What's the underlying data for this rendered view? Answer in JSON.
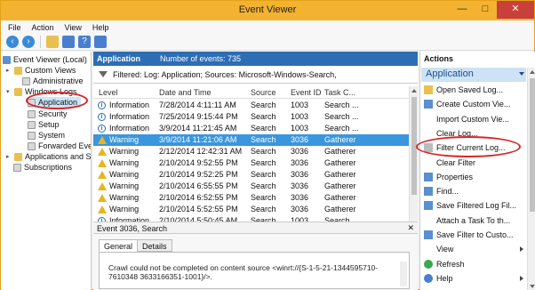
{
  "window": {
    "title": "Event Viewer",
    "min": "—",
    "max": "□",
    "close": "✕"
  },
  "menu": [
    "File",
    "Action",
    "View",
    "Help"
  ],
  "tree": {
    "root": "Event Viewer (Local)",
    "custom_views": "Custom Views",
    "administrative": "Administrative",
    "windows_logs": "Windows Logs",
    "application": "Application",
    "security": "Security",
    "setup": "Setup",
    "system": "System",
    "forwarded": "Forwarded Eve",
    "apps_services": "Applications and S",
    "subscriptions": "Subscriptions"
  },
  "center": {
    "log_name": "Application",
    "events_count": "Number of events: 735",
    "filter_text": "Filtered: Log: Application; Sources: Microsoft-Windows-Search,",
    "columns": [
      "Level",
      "Date and Time",
      "Source",
      "Event ID",
      "Task C..."
    ],
    "rows": [
      {
        "level": "Information",
        "type": "info",
        "date": "7/28/2014 4:11:11 AM",
        "source": "Search",
        "id": "1003",
        "task": "Search ...",
        "selected": false
      },
      {
        "level": "Information",
        "type": "info",
        "date": "7/25/2014 9:15:44 PM",
        "source": "Search",
        "id": "1003",
        "task": "Search ...",
        "selected": false
      },
      {
        "level": "Information",
        "type": "info",
        "date": "3/9/2014 11:21:45 AM",
        "source": "Search",
        "id": "1003",
        "task": "Search ...",
        "selected": false
      },
      {
        "level": "Warning",
        "type": "warn",
        "date": "3/9/2014 11:21:06 AM",
        "source": "Search",
        "id": "3036",
        "task": "Gatherer",
        "selected": true
      },
      {
        "level": "Warning",
        "type": "warn",
        "date": "2/12/2014 12:42:31 AM",
        "source": "Search",
        "id": "3036",
        "task": "Gatherer",
        "selected": false
      },
      {
        "level": "Warning",
        "type": "warn",
        "date": "2/10/2014 9:52:55 PM",
        "source": "Search",
        "id": "3036",
        "task": "Gatherer",
        "selected": false
      },
      {
        "level": "Warning",
        "type": "warn",
        "date": "2/10/2014 9:52:25 PM",
        "source": "Search",
        "id": "3036",
        "task": "Gatherer",
        "selected": false
      },
      {
        "level": "Warning",
        "type": "warn",
        "date": "2/10/2014 6:55:55 PM",
        "source": "Search",
        "id": "3036",
        "task": "Gatherer",
        "selected": false
      },
      {
        "level": "Warning",
        "type": "warn",
        "date": "2/10/2014 6:52:55 PM",
        "source": "Search",
        "id": "3036",
        "task": "Gatherer",
        "selected": false
      },
      {
        "level": "Warning",
        "type": "warn",
        "date": "2/10/2014 5:52:55 PM",
        "source": "Search",
        "id": "3036",
        "task": "Gatherer",
        "selected": false
      },
      {
        "level": "Information",
        "type": "info",
        "date": "2/10/2014 5:50:45 AM",
        "source": "Search",
        "id": "1003",
        "task": "Search ...",
        "selected": false
      }
    ],
    "detail_title": "Event 3036, Search",
    "detail_close": "✕",
    "tab_general": "General",
    "tab_details": "Details",
    "message": "Crawl could not be completed on content source <winrt://{S-1-5-21-1344595710-7610348 3633166351-1001}/>."
  },
  "actions": {
    "title": "Actions",
    "section": "Application",
    "items": [
      {
        "label": "Open Saved Log...",
        "icon": "aic-folder",
        "arrow": false
      },
      {
        "label": "Create Custom Vie...",
        "icon": "aic-blue",
        "arrow": false
      },
      {
        "label": "Import Custom Vie...",
        "icon": "aic-none",
        "arrow": false
      },
      {
        "label": "Clear Log...",
        "icon": "aic-none",
        "arrow": false
      },
      {
        "label": "Filter Current Log...",
        "icon": "aic-grey",
        "arrow": false
      },
      {
        "label": "Clear Filter",
        "icon": "aic-none",
        "arrow": false
      },
      {
        "label": "Properties",
        "icon": "aic-blue",
        "arrow": false
      },
      {
        "label": "Find...",
        "icon": "aic-blue",
        "arrow": false
      },
      {
        "label": "Save Filtered Log Fil...",
        "icon": "aic-blue",
        "arrow": false
      },
      {
        "label": "Attach a Task To th...",
        "icon": "aic-none",
        "arrow": false
      },
      {
        "label": "Save Filter to Custo...",
        "icon": "aic-blue",
        "arrow": false
      },
      {
        "label": "View",
        "icon": "aic-none",
        "arrow": true
      },
      {
        "label": "Refresh",
        "icon": "aic-refresh",
        "arrow": false
      },
      {
        "label": "Help",
        "icon": "aic-help",
        "arrow": true
      }
    ]
  },
  "colors": {
    "accent": "#2d6db4",
    "highlight": "#d8262a",
    "selected_row": "#3a96dd",
    "titlebar": "#f3b230"
  }
}
